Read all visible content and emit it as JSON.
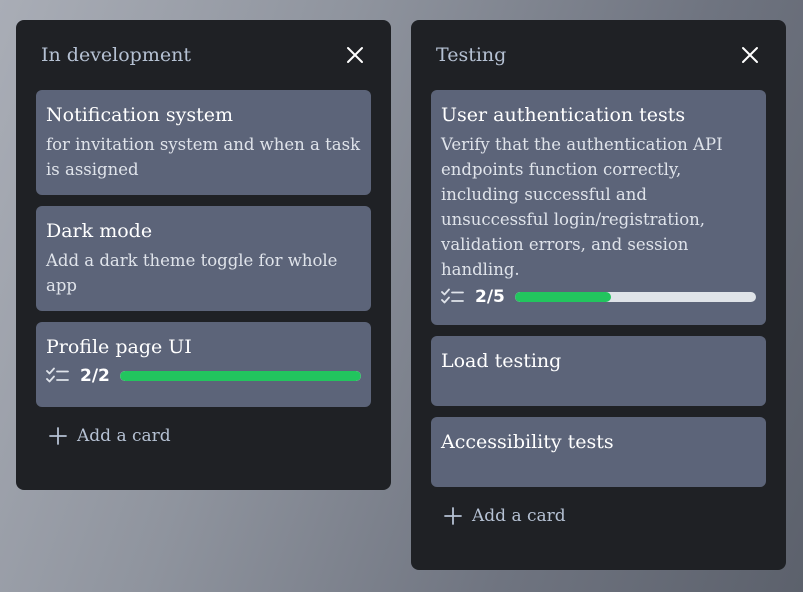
{
  "columns": [
    {
      "title": "In development",
      "add_label": "Add a card",
      "cards": [
        {
          "title": "Notification system",
          "description": "for invitation system and when a task is assigned"
        },
        {
          "title": "Dark mode",
          "description": "Add a dark theme toggle for whole app"
        },
        {
          "title": "Profile page UI",
          "checklist": {
            "label": "2/2",
            "done": 2,
            "total": 2
          }
        }
      ]
    },
    {
      "title": "Testing",
      "add_label": "Add a card",
      "cards": [
        {
          "title": "User authentication tests",
          "description": "Verify that the authentication API endpoints function correctly, including successful and unsuccessful login/registration, validation errors, and session handling.",
          "checklist": {
            "label": "2/5",
            "done": 2,
            "total": 5
          }
        },
        {
          "title": "Load testing"
        },
        {
          "title": "Accessibility tests"
        }
      ]
    }
  ],
  "colors": {
    "progress": "#22c55e",
    "card": "#5c6479",
    "column": "#1f2125"
  },
  "icons": {
    "close": "close-icon",
    "checklist": "checklist-icon",
    "add": "plus-icon"
  }
}
